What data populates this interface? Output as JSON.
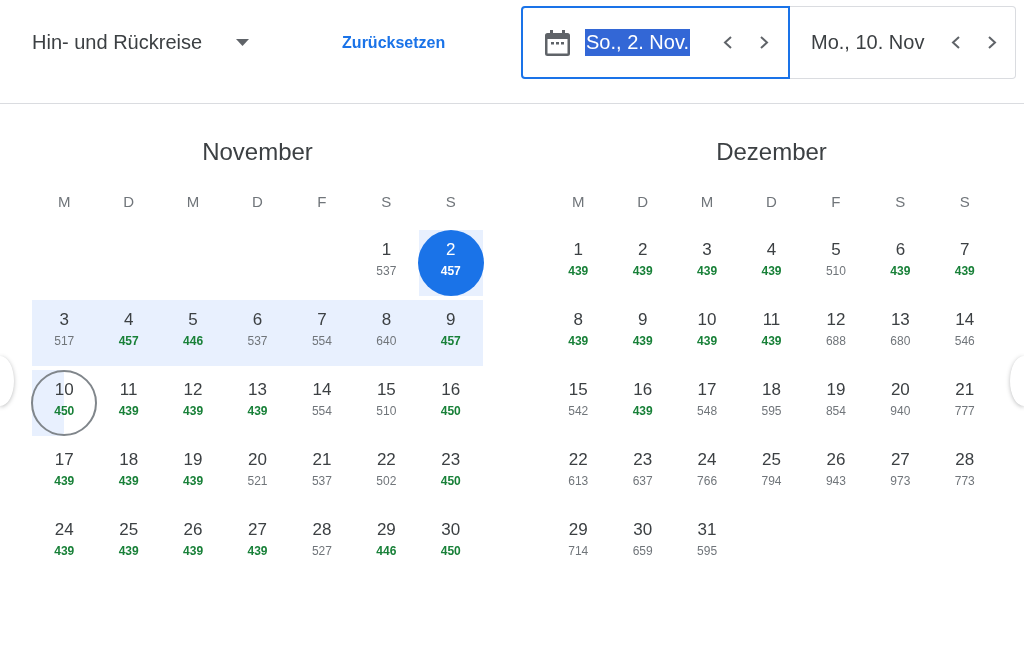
{
  "trip_type": {
    "label": "Hin- und Rückreise"
  },
  "reset_link": {
    "label": "Zurücksetzen"
  },
  "date_fields": [
    {
      "value": "So., 2. Nov.",
      "focused": true,
      "text_selected": true
    },
    {
      "value": "Mo., 10. Nov",
      "focused": false,
      "text_selected": false
    }
  ],
  "months": [
    {
      "title": "November",
      "weekdays": [
        "M",
        "D",
        "M",
        "D",
        "F",
        "S",
        "S"
      ],
      "weeks": [
        {
          "days": [
            {
              "day": "1",
              "price": "537",
              "cheap": false,
              "selected": false
            },
            {
              "day": "2",
              "price": "457",
              "cheap": true,
              "selected": true
            }
          ]
        },
        {
          "days": [
            {
              "day": "3",
              "price": "517",
              "cheap": false,
              "selected": false
            },
            {
              "day": "4",
              "price": "457",
              "cheap": true,
              "selected": false
            },
            {
              "day": "5",
              "price": "446",
              "cheap": true,
              "selected": false
            },
            {
              "day": "6",
              "price": "537",
              "cheap": false,
              "selected": false
            },
            {
              "day": "7",
              "price": "554",
              "cheap": false,
              "selected": false
            },
            {
              "day": "8",
              "price": "640",
              "cheap": false,
              "selected": false
            },
            {
              "day": "9",
              "price": "457",
              "cheap": true,
              "selected": false
            }
          ]
        },
        {
          "days": [
            {
              "day": "10",
              "price": "450",
              "cheap": true,
              "selected": true
            },
            {
              "day": "11",
              "price": "439",
              "cheap": true,
              "selected": false
            },
            {
              "day": "12",
              "price": "439",
              "cheap": true,
              "selected": false
            },
            {
              "day": "13",
              "price": "439",
              "cheap": true,
              "selected": false
            },
            {
              "day": "14",
              "price": "554",
              "cheap": false,
              "selected": false
            },
            {
              "day": "15",
              "price": "510",
              "cheap": false,
              "selected": false
            },
            {
              "day": "16",
              "price": "450",
              "cheap": true,
              "selected": false
            }
          ]
        },
        {
          "days": [
            {
              "day": "17",
              "price": "439",
              "cheap": true,
              "selected": false
            },
            {
              "day": "18",
              "price": "439",
              "cheap": true,
              "selected": false
            },
            {
              "day": "19",
              "price": "439",
              "cheap": true,
              "selected": false
            },
            {
              "day": "20",
              "price": "521",
              "cheap": false,
              "selected": false
            },
            {
              "day": "21",
              "price": "537",
              "cheap": false,
              "selected": false
            },
            {
              "day": "22",
              "price": "502",
              "cheap": false,
              "selected": false
            },
            {
              "day": "23",
              "price": "450",
              "cheap": true,
              "selected": false
            }
          ]
        },
        {
          "days": [
            {
              "day": "24",
              "price": "439",
              "cheap": true,
              "selected": false
            },
            {
              "day": "25",
              "price": "439",
              "cheap": true,
              "selected": false
            },
            {
              "day": "26",
              "price": "439",
              "cheap": true,
              "selected": false
            },
            {
              "day": "27",
              "price": "439",
              "cheap": true,
              "selected": false
            },
            {
              "day": "28",
              "price": "527",
              "cheap": false,
              "selected": false
            },
            {
              "day": "29",
              "price": "446",
              "cheap": true,
              "selected": false
            },
            {
              "day": "30",
              "price": "450",
              "cheap": true,
              "selected": false
            }
          ]
        }
      ]
    },
    {
      "title": "Dezember",
      "weekdays": [
        "M",
        "D",
        "M",
        "D",
        "F",
        "S",
        "S"
      ],
      "weeks": [
        {
          "days": [
            {
              "day": "1",
              "price": "439",
              "cheap": true,
              "selected": false
            },
            {
              "day": "2",
              "price": "439",
              "cheap": true,
              "selected": false
            },
            {
              "day": "3",
              "price": "439",
              "cheap": true,
              "selected": false
            },
            {
              "day": "4",
              "price": "439",
              "cheap": true,
              "selected": false
            },
            {
              "day": "5",
              "price": "510",
              "cheap": false,
              "selected": false
            },
            {
              "day": "6",
              "price": "439",
              "cheap": true,
              "selected": false
            },
            {
              "day": "7",
              "price": "439",
              "cheap": true,
              "selected": false
            }
          ]
        },
        {
          "days": [
            {
              "day": "8",
              "price": "439",
              "cheap": true,
              "selected": false
            },
            {
              "day": "9",
              "price": "439",
              "cheap": true,
              "selected": false
            },
            {
              "day": "10",
              "price": "439",
              "cheap": true,
              "selected": false
            },
            {
              "day": "11",
              "price": "439",
              "cheap": true,
              "selected": false
            },
            {
              "day": "12",
              "price": "688",
              "cheap": false,
              "selected": false
            },
            {
              "day": "13",
              "price": "680",
              "cheap": false,
              "selected": false
            },
            {
              "day": "14",
              "price": "546",
              "cheap": false,
              "selected": false
            }
          ]
        },
        {
          "days": [
            {
              "day": "15",
              "price": "542",
              "cheap": false,
              "selected": false
            },
            {
              "day": "16",
              "price": "439",
              "cheap": true,
              "selected": false
            },
            {
              "day": "17",
              "price": "548",
              "cheap": false,
              "selected": false
            },
            {
              "day": "18",
              "price": "595",
              "cheap": false,
              "selected": false
            },
            {
              "day": "19",
              "price": "854",
              "cheap": false,
              "selected": false
            },
            {
              "day": "20",
              "price": "940",
              "cheap": false,
              "selected": false
            },
            {
              "day": "21",
              "price": "777",
              "cheap": false,
              "selected": false
            }
          ]
        },
        {
          "days": [
            {
              "day": "22",
              "price": "613",
              "cheap": false,
              "selected": false
            },
            {
              "day": "23",
              "price": "637",
              "cheap": false,
              "selected": false
            },
            {
              "day": "24",
              "price": "766",
              "cheap": false,
              "selected": false
            },
            {
              "day": "25",
              "price": "794",
              "cheap": false,
              "selected": false
            },
            {
              "day": "26",
              "price": "943",
              "cheap": false,
              "selected": false
            },
            {
              "day": "27",
              "price": "973",
              "cheap": false,
              "selected": false
            },
            {
              "day": "28",
              "price": "773",
              "cheap": false,
              "selected": false
            }
          ]
        },
        {
          "days": [
            {
              "day": "29",
              "price": "714",
              "cheap": false,
              "selected": false
            },
            {
              "day": "30",
              "price": "659",
              "cheap": false,
              "selected": false
            },
            {
              "day": "31",
              "price": "595",
              "cheap": false,
              "selected": false
            }
          ]
        }
      ]
    }
  ]
}
